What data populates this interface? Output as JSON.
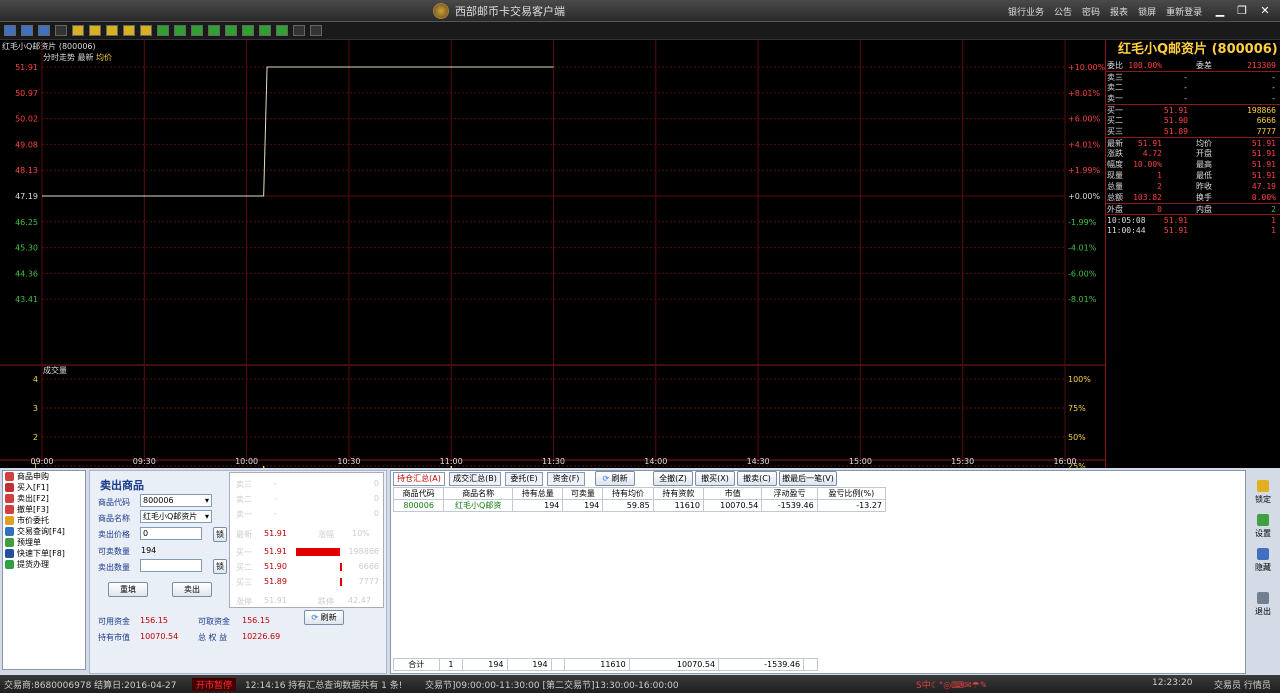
{
  "window": {
    "title": "西部邮币卡交易客户端",
    "menu": [
      "银行业务",
      "公告",
      "密码",
      "报表",
      "锁屏",
      "重新登录"
    ]
  },
  "toolbar": {
    "icons": [
      "chart-bar-icon",
      "chart-line-icon",
      "candle-icon",
      "doc-icon",
      "y1",
      "y2",
      "y3",
      "y4",
      "y5",
      "g1",
      "g2",
      "g3",
      "g4",
      "g5",
      "g6",
      "g7",
      "g8",
      "print-icon",
      "gear-icon"
    ]
  },
  "chart": {
    "symbol_header": "红毛小Q邮资片 (800006)",
    "subtitle": "分时走势 最新",
    "subtitle2": "均价",
    "volume_label": "成交量",
    "y_labels": [
      "51.91",
      "50.97",
      "50.02",
      "49.08",
      "48.13",
      "47.19",
      "46.25",
      "45.30",
      "44.36",
      "43.41"
    ],
    "pct_labels": [
      "+10.00%",
      "+8.01%",
      "+6.00%",
      "+4.01%",
      "+1.99%",
      "+0.00%",
      "-1.99%",
      "-4.01%",
      "-6.00%",
      "-8.01%"
    ],
    "vol_labels": [
      "4",
      "3",
      "2",
      "1"
    ],
    "vol_pct": [
      "100%",
      "75%",
      "50%",
      "25%"
    ],
    "x_labels": [
      "09:00",
      "09:30",
      "10:00",
      "10:30",
      "11:00",
      "11:30",
      "14:00",
      "14:30",
      "15:00",
      "15:30",
      "16:00"
    ]
  },
  "chart_data": {
    "type": "line",
    "title": "红毛小Q邮资片 (800006)",
    "x": [
      "09:00",
      "10:05",
      "10:06",
      "11:30"
    ],
    "series": [
      {
        "name": "最新",
        "values": [
          47.19,
          47.19,
          51.91,
          51.91
        ]
      }
    ],
    "volume": [
      {
        "time": "10:05",
        "value": 1
      },
      {
        "time": "11:00",
        "value": 1
      }
    ],
    "ylim": [
      43.41,
      51.91
    ]
  },
  "quote": {
    "title": "红毛小Q邮资片 (800006)",
    "top": [
      [
        "委比",
        "100.00%",
        "委差",
        "213309"
      ]
    ],
    "asks": [
      [
        "卖三",
        "-",
        "-"
      ],
      [
        "卖二",
        "-",
        "-"
      ],
      [
        "卖一",
        "-",
        "-"
      ]
    ],
    "bids": [
      [
        "买一",
        "51.91",
        "198866"
      ],
      [
        "买二",
        "51.90",
        "6666"
      ],
      [
        "买三",
        "51.89",
        "7777"
      ]
    ],
    "stats": [
      [
        "最新",
        "51.91",
        "均价",
        "51.91"
      ],
      [
        "涨跌",
        "4.72",
        "开盘",
        "51.91"
      ],
      [
        "幅度",
        "10.00%",
        "最高",
        "51.91"
      ],
      [
        "现量",
        "1",
        "最低",
        "51.91"
      ],
      [
        "总量",
        "2",
        "昨收",
        "47.19"
      ],
      [
        "总额",
        "103.82",
        "换手",
        "0.00%"
      ],
      [
        "外盘",
        "0",
        "内盘",
        "2"
      ]
    ],
    "ticks": [
      [
        "10:05:08",
        "51.91",
        "1"
      ],
      [
        "11:00:44",
        "51.91",
        "1"
      ]
    ]
  },
  "nav": [
    "商品申购",
    "买入[F1]",
    "卖出[F2]",
    "撤单[F3]",
    "市价委托",
    "交易查询[F4]",
    "预埋单",
    "快速下单[F8]",
    "提货办理"
  ],
  "form": {
    "title": "卖出商品",
    "code_label": "商品代码",
    "code": "800006",
    "name_label": "商品名称",
    "name": "红毛小Q邮资片",
    "price_label": "卖出价格",
    "price": "0",
    "lock": "锁",
    "avail_label": "可卖数量",
    "avail": "194",
    "qty_label": "卖出数量",
    "reset": "重填",
    "sell": "卖出",
    "funds": [
      [
        "可用资金",
        "156.15",
        "可取资金",
        "156.15"
      ],
      [
        "持有市值",
        "10070.54",
        "总 权 益",
        "10226.69"
      ]
    ],
    "refresh": "刷新"
  },
  "book": {
    "asks": [
      [
        "卖三",
        "-",
        "0"
      ],
      [
        "卖二",
        "-",
        "0"
      ],
      [
        "卖一",
        "-",
        "0"
      ]
    ],
    "latest": [
      "最新",
      "51.91",
      "涨幅",
      "10%"
    ],
    "bids": [
      [
        "买一",
        "51.91",
        "198866"
      ],
      [
        "买二",
        "51.90",
        "6666"
      ],
      [
        "买三",
        "51.89",
        "7777"
      ]
    ],
    "limit": [
      "涨停",
      "51.91",
      "跌停",
      "42.47"
    ]
  },
  "positions": {
    "tabs": [
      "持仓汇总(A)",
      "成交汇总(B)",
      "委托(E)",
      "资金(F)"
    ],
    "refresh": "刷新",
    "actions": [
      "全撤(Z)",
      "撤买(X)",
      "撤卖(C)",
      "撤最后一笔(V)"
    ],
    "headers": [
      "商品代码",
      "商品名称",
      "持有总量",
      "可卖量",
      "持有均价",
      "持有资款",
      "市值",
      "浮动盈亏",
      "盈亏比例(%)"
    ],
    "rows": [
      [
        "800006",
        "红毛小Q邮资",
        "194",
        "194",
        "59.85",
        "11610",
        "10070.54",
        "-1539.46",
        "-13.27"
      ]
    ],
    "total": [
      "合计",
      "1",
      "194",
      "194",
      "",
      "11610",
      "10070.54",
      "-1539.46",
      ""
    ]
  },
  "rside": [
    "锁定",
    "设置",
    "隐藏",
    "退出"
  ],
  "status": {
    "dealer": "交易商:8680006978 结算日:2016-04-27",
    "state": "开市暂停",
    "msg": "12:14:16 持有汇总查询数据共有 1 条!",
    "session": "交易节]09:00:00-11:30:00 [第二交易节]13:30:00-16:00:00",
    "time": "12:23:20",
    "right": "交易员  行情员"
  }
}
